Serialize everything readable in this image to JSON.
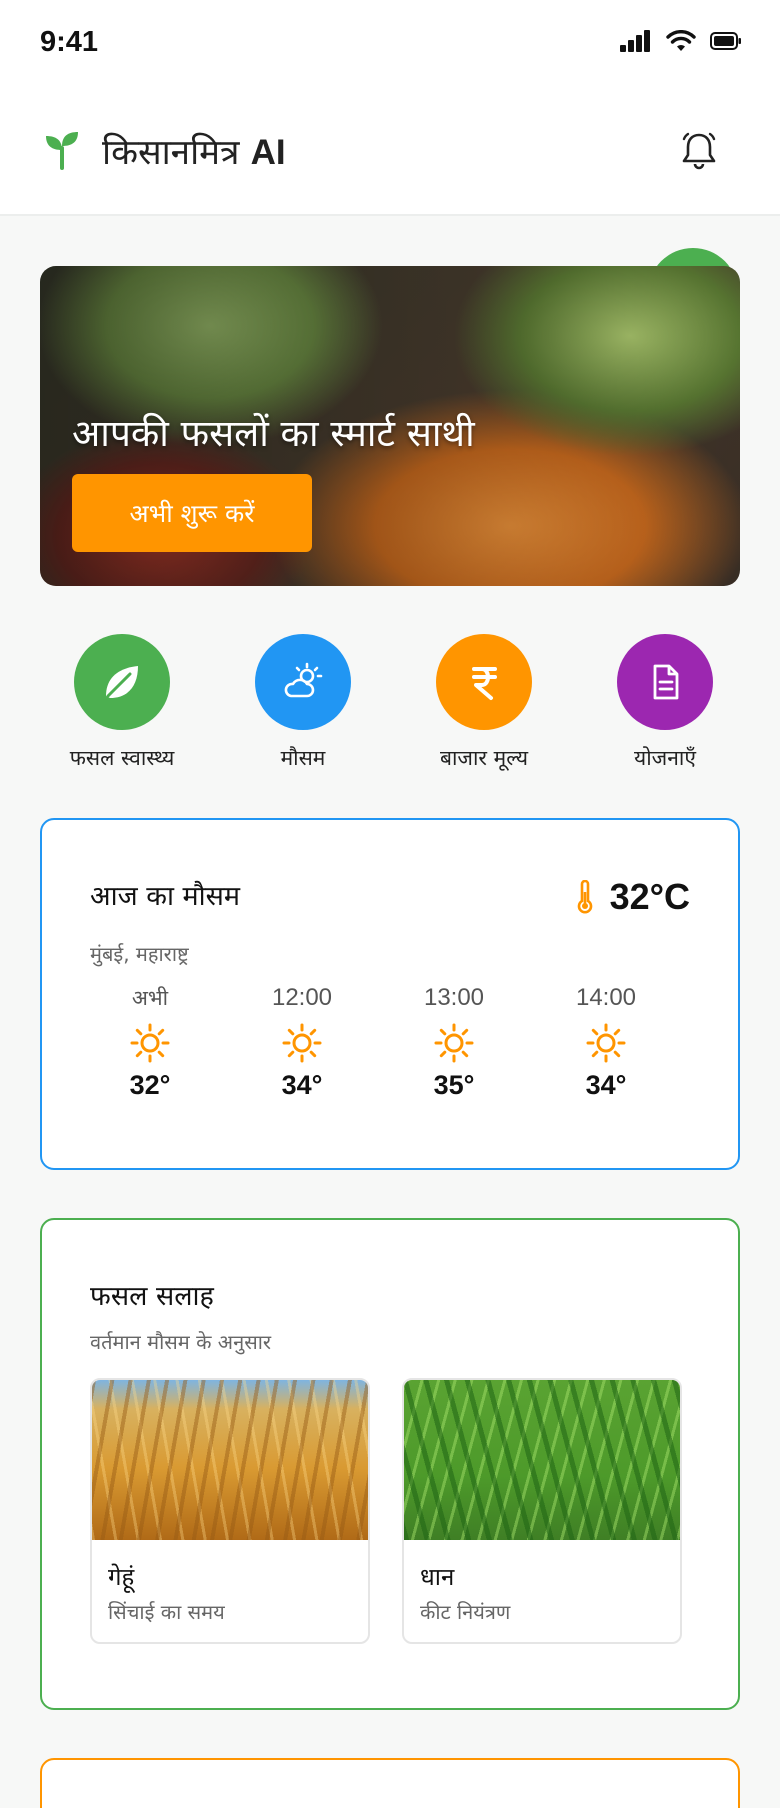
{
  "status_bar": {
    "time": "9:41"
  },
  "header": {
    "app_name": "किसानमित्र",
    "app_name_suffix": "AI"
  },
  "hero": {
    "title": "आपकी फसलों का स्मार्ट साथी",
    "cta_label": "अभी शुरू करें"
  },
  "quick_actions": [
    {
      "label": "फसल स्वास्थ्य",
      "icon": "leaf-icon",
      "color": "#4caf50"
    },
    {
      "label": "मौसम",
      "icon": "sun-cloud-icon",
      "color": "#2196f3"
    },
    {
      "label": "बाजार मूल्य",
      "icon": "rupee-icon",
      "color": "#ff9500"
    },
    {
      "label": "योजनाएँ",
      "icon": "document-icon",
      "color": "#9c27b0"
    }
  ],
  "weather": {
    "title": "आज का मौसम",
    "location": "मुंबई, महाराष्ट्र",
    "current_temp": "32°C",
    "hourly": [
      {
        "time": "अभी",
        "temp": "32°",
        "icon": "sun-icon"
      },
      {
        "time": "12:00",
        "temp": "34°",
        "icon": "sun-icon"
      },
      {
        "time": "13:00",
        "temp": "35°",
        "icon": "sun-icon"
      },
      {
        "time": "14:00",
        "temp": "34°",
        "icon": "sun-icon"
      }
    ]
  },
  "crop_advice": {
    "title": "फसल सलाह",
    "subtitle": "वर्तमान मौसम के अनुसार",
    "crops": [
      {
        "name": "गेहूं",
        "note": "सिंचाई का समय"
      },
      {
        "name": "धान",
        "note": "कीट नियंत्रण"
      }
    ]
  },
  "colors": {
    "accent_green": "#4caf50",
    "accent_orange": "#ff9500",
    "accent_blue": "#2196f3",
    "accent_purple": "#9c27b0"
  }
}
